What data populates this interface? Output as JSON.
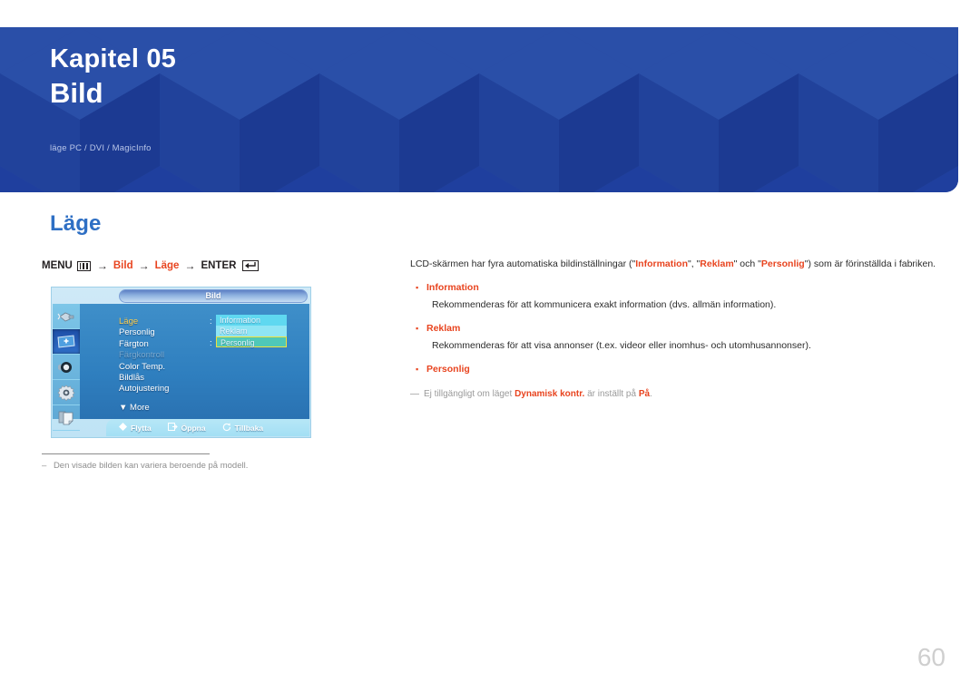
{
  "banner": {
    "chapter": "Kapitel 05",
    "title": "Bild",
    "subtitle": "läge PC / DVI / MagicInfo",
    "bg_color": "#1f3f9e"
  },
  "section": {
    "title": "Läge",
    "title_color": "#2e6fc4"
  },
  "menu_path": {
    "menu_label": "MENU",
    "menu_icon": "menu-bars-icon",
    "arrow": "→",
    "step1": "Bild",
    "step2": "Läge",
    "enter_label": "ENTER",
    "enter_icon": "enter-return-icon",
    "highlight_color": "#e8441f"
  },
  "osd": {
    "title": "Bild",
    "sidebar_icons": [
      "input-source-icon",
      "picture-display-icon",
      "sound-speaker-icon",
      "setup-gear-icon",
      "multi-control-icon"
    ],
    "selected_sidebar_index": 1,
    "items": [
      {
        "label": "Läge",
        "state": "active",
        "has_colon": true
      },
      {
        "label": "Personlig",
        "state": "normal",
        "has_colon": false
      },
      {
        "label": "Färgton",
        "state": "normal",
        "has_colon": true
      },
      {
        "label": "Färgkontroll",
        "state": "disabled",
        "has_colon": false
      },
      {
        "label": "Color Temp.",
        "state": "normal",
        "has_colon": false
      },
      {
        "label": "Bildlås",
        "state": "normal",
        "has_colon": false
      },
      {
        "label": "Autojustering",
        "state": "normal",
        "has_colon": false
      }
    ],
    "more_label": "More",
    "more_icon": "triangle-down-icon",
    "values": [
      {
        "label": "Information",
        "style": "v1"
      },
      {
        "label": "Reklam",
        "style": "v2"
      },
      {
        "label": "Personlig",
        "style": "v3",
        "selected": true
      }
    ],
    "footer": [
      {
        "icon": "move-diamond-icon",
        "label": "Flytta"
      },
      {
        "icon": "open-enter-icon",
        "label": "Öppna"
      },
      {
        "icon": "back-return-icon",
        "label": "Tillbaka"
      }
    ]
  },
  "image_footnote": {
    "dash": "–",
    "text": "Den visade bilden kan variera beroende på modell."
  },
  "body": {
    "lead_before": "LCD-skärmen har fyra automatiska bildinställningar (\"",
    "lead_kw1": "Information",
    "lead_mid1": "\", \"",
    "lead_kw2": "Reklam",
    "lead_mid2": "\" och \"",
    "lead_kw3": "Personlig",
    "lead_after": "\") som är förinställda i fabriken.",
    "bullet_marker": "▪",
    "items": [
      {
        "label": "Information",
        "desc": "Rekommenderas för att kommunicera exakt information (dvs. allmän information)."
      },
      {
        "label": "Reklam",
        "desc": "Rekommenderas för att visa annonser (t.ex. videor eller inomhus- och utomhusannonser)."
      },
      {
        "label": "Personlig",
        "desc": ""
      }
    ],
    "note": {
      "dash": "―",
      "before": "Ej tillgängligt om läget ",
      "kw1": "Dynamisk kontr.",
      "mid": " är inställt på ",
      "kw2": "På",
      "after": "."
    }
  },
  "page_number": "60"
}
